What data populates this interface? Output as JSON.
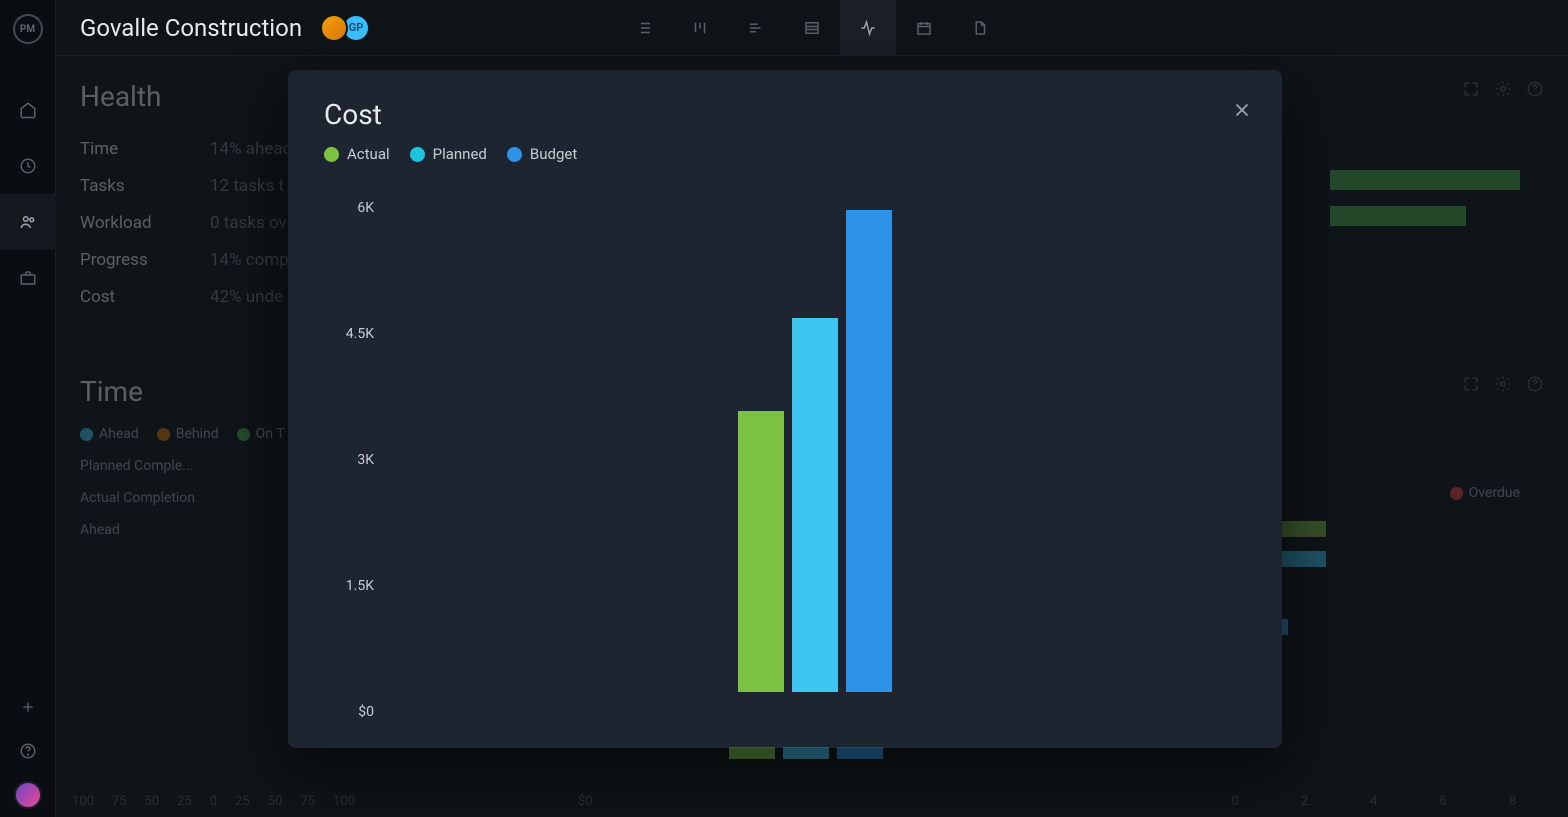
{
  "header": {
    "project_title": "Govalle Construction",
    "logo_text": "PM",
    "badges": [
      "",
      "GP"
    ]
  },
  "sidebar_items": [
    "home",
    "clock",
    "people",
    "briefcase"
  ],
  "top_nav_items": [
    "list",
    "board",
    "timeline",
    "table",
    "activity",
    "calendar",
    "file"
  ],
  "health_panel": {
    "title": "Health",
    "rows": [
      {
        "label": "Time",
        "value": "14% ahead"
      },
      {
        "label": "Tasks",
        "value": "12 tasks t"
      },
      {
        "label": "Workload",
        "value": "0 tasks ov"
      },
      {
        "label": "Progress",
        "value": "14% comp"
      },
      {
        "label": "Cost",
        "value": "42% unde"
      }
    ]
  },
  "time_panel": {
    "title": "Time",
    "legend": [
      {
        "label": "Ahead",
        "color": "#3dc6ef"
      },
      {
        "label": "Behind",
        "color": "#d97706"
      },
      {
        "label": "On T",
        "color": "#4cac4c"
      }
    ],
    "rows": [
      "Planned Comple...",
      "Actual Completion",
      "Ahead"
    ],
    "axis": [
      "100",
      "75",
      "50",
      "25",
      "0",
      "25",
      "50",
      "75",
      "100"
    ]
  },
  "tasks_bg": {
    "legend_last": "Overdue",
    "axis": [
      "0",
      "2",
      "4",
      "6",
      "8"
    ]
  },
  "cost_bg_axis": "$0",
  "modal": {
    "title": "Cost",
    "legend": [
      {
        "label": "Actual",
        "color": "#7cc142"
      },
      {
        "label": "Planned",
        "color": "#3dc6ef"
      },
      {
        "label": "Budget",
        "color": "#2c93e8"
      }
    ],
    "y_ticks": [
      "6K",
      "4.5K",
      "3K",
      "1.5K",
      "$0"
    ]
  },
  "chart_data": {
    "type": "bar",
    "title": "Cost",
    "categories": [
      "Actual",
      "Planned",
      "Budget"
    ],
    "values": [
      3500,
      4650,
      6000
    ],
    "ylabel": "",
    "xlabel": "",
    "ylim": [
      0,
      6000
    ],
    "series_colors": [
      "#7cc142",
      "#3dc6ef",
      "#2c93e8"
    ]
  }
}
